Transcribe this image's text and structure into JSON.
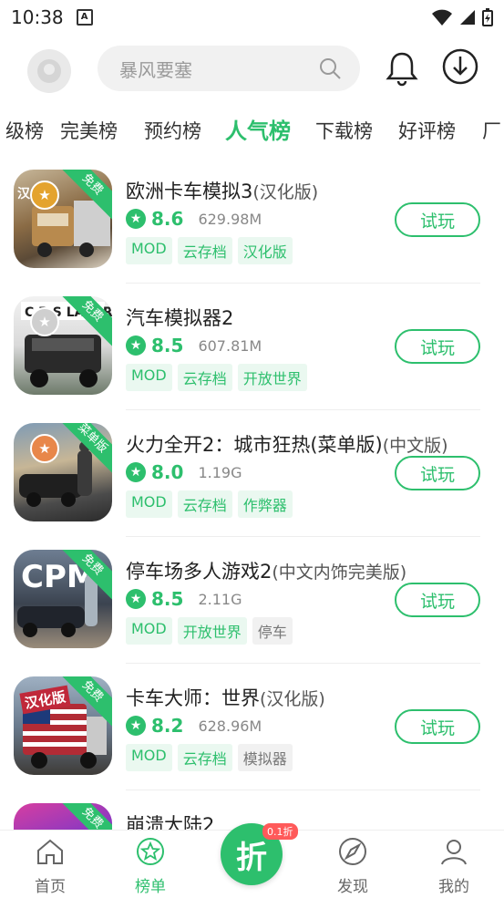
{
  "status": {
    "time": "10:38",
    "notif_icon": "A"
  },
  "search": {
    "placeholder": "暴风要塞"
  },
  "tabs": [
    {
      "label": "级榜"
    },
    {
      "label": "完美榜"
    },
    {
      "label": "预约榜"
    },
    {
      "label": "人气榜",
      "active": true
    },
    {
      "label": "下载榜"
    },
    {
      "label": "好评榜"
    },
    {
      "label": "厂"
    }
  ],
  "games": [
    {
      "name": "欧洲卡车模拟3",
      "suffix": "(汉化版)",
      "score": "8.6",
      "size": "629.98M",
      "tags": [
        "MOD",
        "云存档",
        "汉化版"
      ],
      "ribbon": "免费",
      "button": "试玩"
    },
    {
      "name": "汽车模拟器2",
      "suffix": "",
      "score": "8.5",
      "size": "607.81M",
      "tags": [
        "MOD",
        "云存档",
        "开放世界"
      ],
      "ribbon": "免费",
      "button": "试玩"
    },
    {
      "name": "火力全开2：城市狂热(菜单版)",
      "suffix": "(中文版)",
      "score": "8.0",
      "size": "1.19G",
      "tags": [
        "MOD",
        "云存档",
        "作弊器"
      ],
      "ribbon": "菜单版",
      "button": "试玩"
    },
    {
      "name": "停车场多人游戏2",
      "suffix": "(中文内饰完美版)",
      "score": "8.5",
      "size": "2.11G",
      "tags": [
        "MOD",
        "开放世界",
        "停车"
      ],
      "ribbon": "免费",
      "button": "试玩"
    },
    {
      "name": "卡车大师：世界",
      "suffix": "(汉化版)",
      "score": "8.2",
      "size": "628.96M",
      "tags": [
        "MOD",
        "云存档",
        "模拟器"
      ],
      "ribbon": "免费",
      "button": "试玩"
    },
    {
      "name": "崩溃大陆2",
      "suffix": "",
      "score": "",
      "size": "",
      "tags": [],
      "ribbon": "免费",
      "button": ""
    }
  ],
  "icon_text": {
    "item1": "汉",
    "item4": "CPM",
    "item5": "汉化版"
  },
  "nav": {
    "home": "首页",
    "rank": "榜单",
    "center": "折",
    "center_badge": "0.1折",
    "discover": "发现",
    "mine": "我的"
  },
  "colors": {
    "accent": "#2dbf6d"
  }
}
